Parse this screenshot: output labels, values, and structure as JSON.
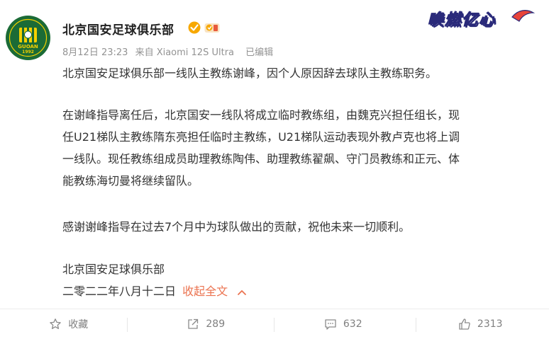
{
  "account": {
    "name": "北京国安足球俱乐部",
    "avatar_text": "GUOAN",
    "avatar_year": "1992"
  },
  "meta": {
    "date": "8月12日 23:23",
    "source": "来自 Xiaomi 12S Ultra",
    "edited": "已编辑"
  },
  "brand": {
    "logo_text": "唤燃亿心"
  },
  "post": {
    "p1": "北京国安足球俱乐部一线队主教练谢峰，因个人原因辞去球队主教练职务。",
    "p2_line1": "在谢峰指导离任后，北京国安一线队将成立临时教练组，由魏克兴担任组长，现",
    "p2_line2": "任U21梯队主教练隋东亮担任临时主教练，U21梯队运动表现外教卢克也将上调",
    "p2_line3": "一线队。现任教练组成员助理教练陶伟、助理教练翟飙、守门员教练和正元、体",
    "p2_line4": "能教练海切曼将继续留队。",
    "p3": "感谢谢峰指导在过去7个月中为球队做出的贡献，祝他未来一切顺利。",
    "signature": "北京国安足球俱乐部",
    "date_signed": "二零二二年八月十二日",
    "collapse_label": "收起全文"
  },
  "actions": {
    "favorite_label": "收藏",
    "repost_count": "289",
    "comment_count": "632",
    "like_count": "2313"
  },
  "colors": {
    "accent": "#eb7350",
    "verified": "#f7a800",
    "text": "#333333",
    "meta": "#939393",
    "avatar_green": "#1b6b36",
    "avatar_yellow": "#f5d100"
  },
  "icons": [
    "verified-icon",
    "vip-badge-icon",
    "chevron-up-icon",
    "star-icon",
    "repost-icon",
    "comment-icon",
    "like-icon"
  ]
}
